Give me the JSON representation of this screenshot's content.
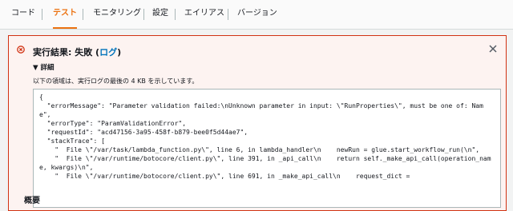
{
  "tabs": [
    {
      "label": "コード"
    },
    {
      "label": "テスト",
      "active": true
    },
    {
      "label": "モニタリング"
    },
    {
      "label": "設定"
    },
    {
      "label": "エイリアス"
    },
    {
      "label": "バージョン"
    }
  ],
  "result": {
    "title_prefix": "実行結果: 失敗 (",
    "log_link": "ログ",
    "title_suffix": ")",
    "details_label": "▼ 詳細",
    "description": "以下の領域は、実行ログの最後の 4 KB を示しています。",
    "code": "{\n  \"errorMessage\": \"Parameter validation failed:\\nUnknown parameter in input: \\\"RunProperties\\\", must be one of: Name\",\n  \"errorType\": \"ParamValidationError\",\n  \"requestId\": \"acd47156-3a95-458f-b879-bee0f5d44ae7\",\n  \"stackTrace\": [\n    \"  File \\\"/var/task/lambda_function.py\\\", line 6, in lambda_handler\\n    newRun = glue.start_workflow_run(\\n\",\n    \"  File \\\"/var/runtime/botocore/client.py\\\", line 391, in _api_call\\n    return self._make_api_call(operation_name, kwargs)\\n\",\n    \"  File \\\"/var/runtime/botocore/client.py\\\", line 691, in _make_api_call\\n    request_dict =",
    "summary_label": "概要"
  },
  "colors": {
    "error": "#d13212",
    "accent": "#ec7211",
    "link": "#0073bb"
  },
  "icons": {
    "status": "error-circle-icon",
    "close": "close-icon"
  }
}
